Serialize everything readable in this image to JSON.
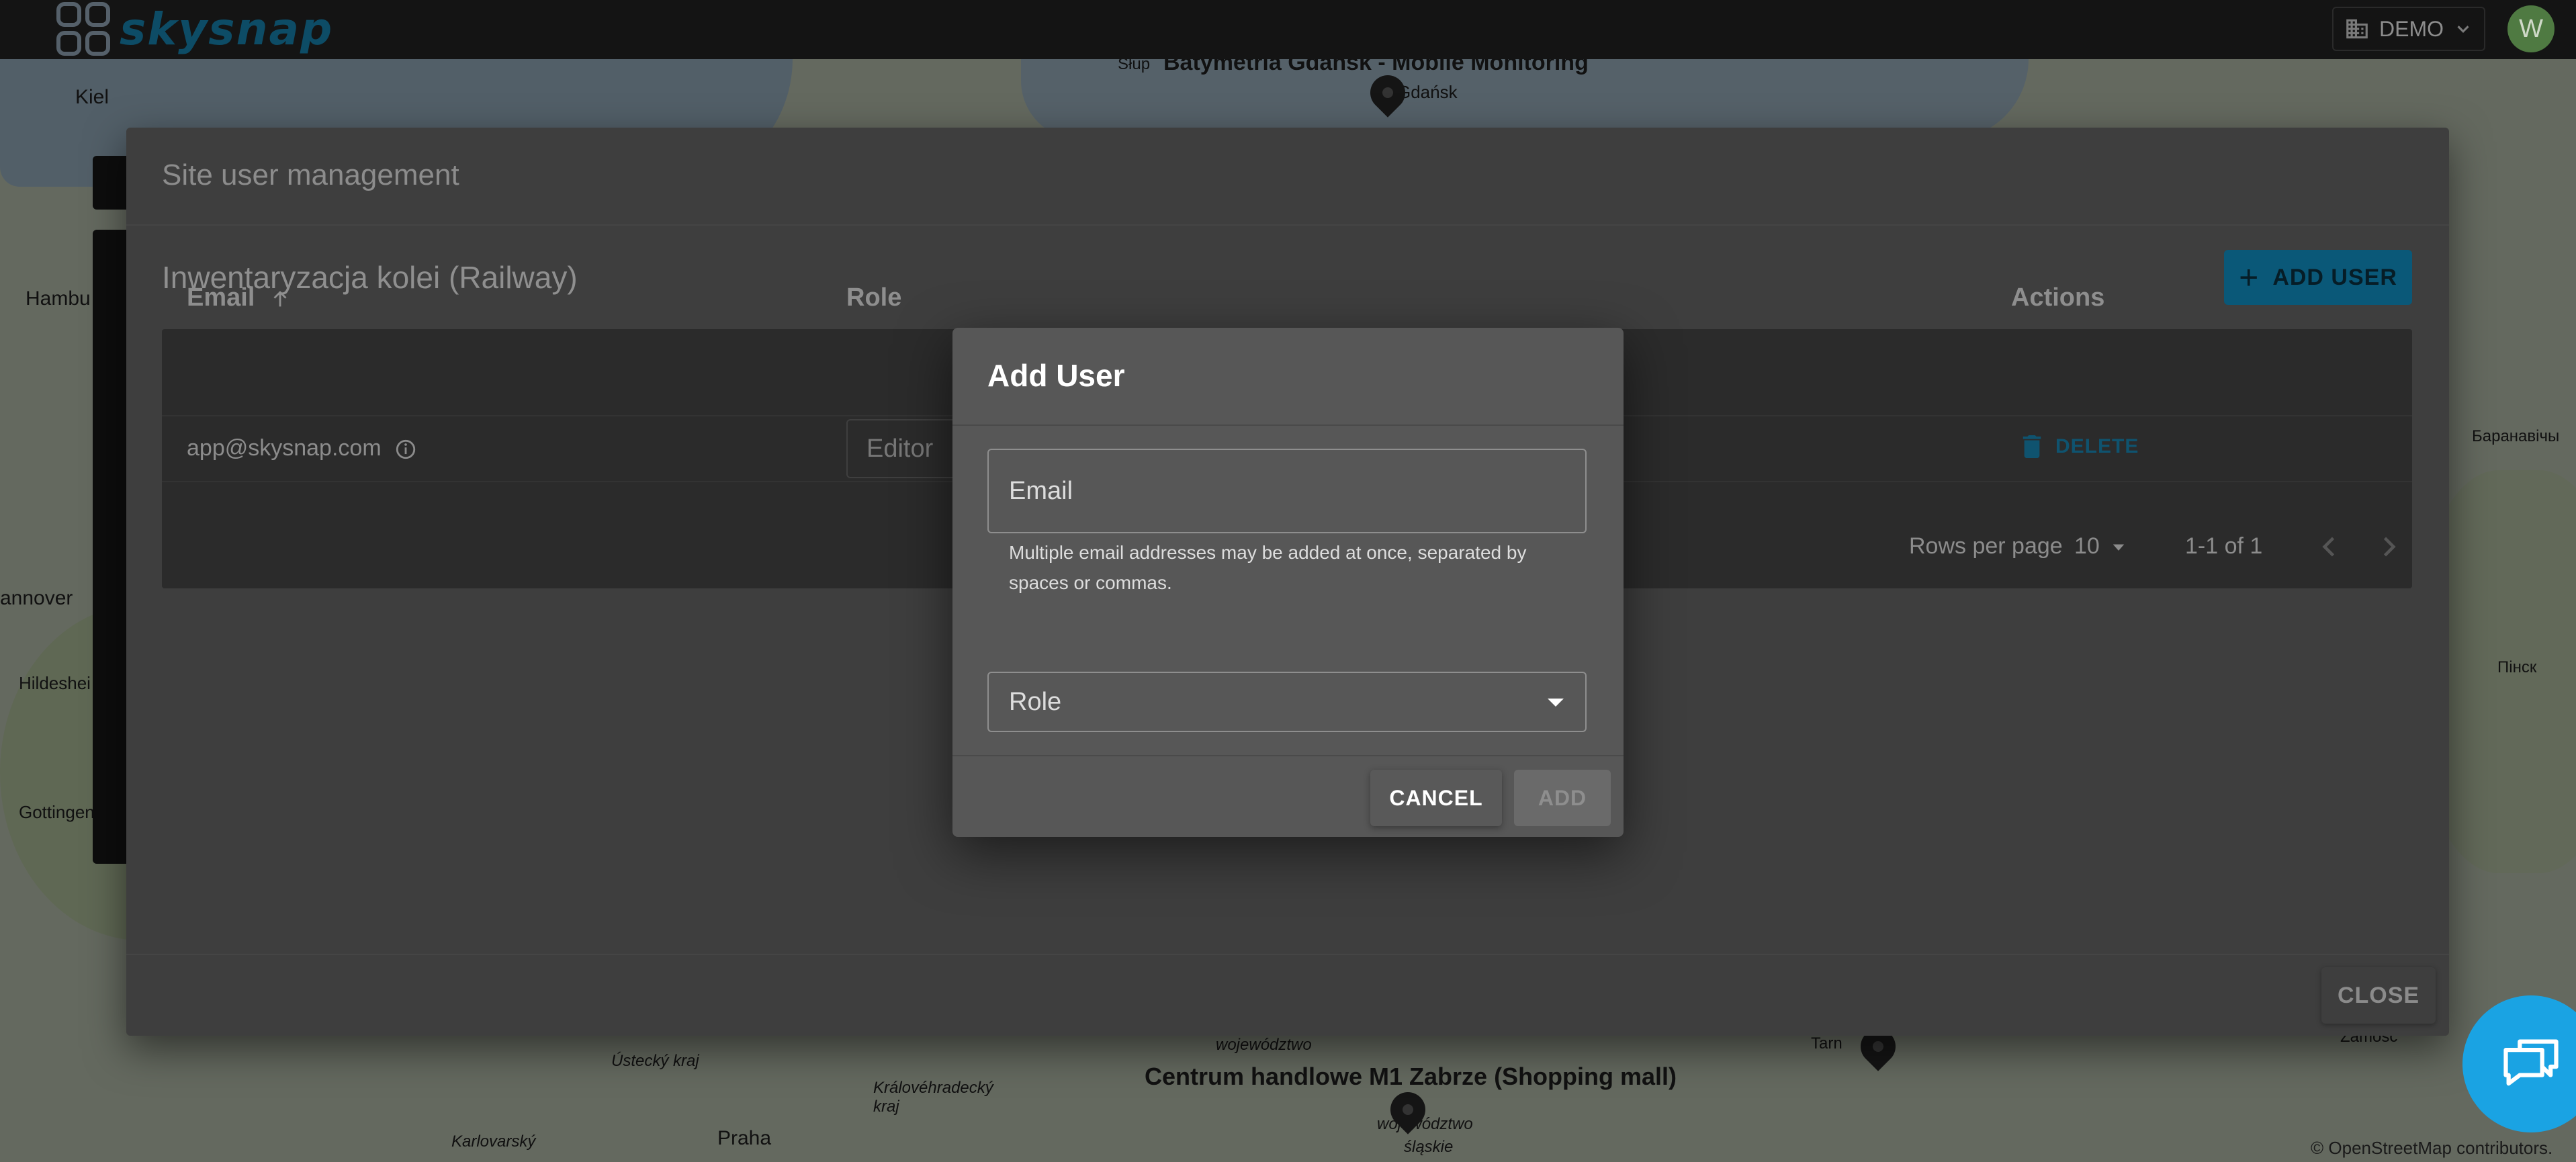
{
  "app": {
    "logo_text": "skysnap",
    "workspace": "DEMO",
    "avatar_initial": "W"
  },
  "map": {
    "labels": {
      "kiel": "Kiel",
      "hamburg": "Hambu",
      "hannover": "annover",
      "hildesheim": "Hildeshei",
      "gottingen": "Gottingen",
      "baranavichy": "Баранавічы",
      "pinsk": "Пінск",
      "site_top": "Batymetria Gdańsk - Mobile Monitoring",
      "site_top_prefix": "Słup",
      "site_top_sub": "Gdańsk",
      "site_bottom": "Centrum handlowe M1 Zabrze (Shopping mall)",
      "praha": "Praha",
      "karlovarsky": "Karlovarský",
      "ustecky": "Ústecký kraj",
      "kralovehradecky": "Královéhradecký kraj",
      "wojewodztwo_a": "województwo",
      "wojewodztwo_b": "województwo",
      "slaskie": "śląskie",
      "tarnow": "Tarn",
      "zamosc": "Zamość"
    },
    "attribution": "© OpenStreetMap contributors."
  },
  "site_user_management": {
    "title": "Site user management",
    "site_name": "Inwentaryzacja kolei (Railway)",
    "add_user_label": "ADD USER",
    "columns": {
      "email": "Email",
      "role": "Role",
      "actions": "Actions"
    },
    "rows": [
      {
        "email": "app@skysnap.com",
        "role": "Editor",
        "action": "DELETE"
      }
    ],
    "pagination": {
      "rows_per_page_label": "Rows per page",
      "rows_per_page_value": "10",
      "range": "1-1 of 1"
    },
    "close_label": "CLOSE"
  },
  "add_user_modal": {
    "title": "Add User",
    "email_placeholder": "Email",
    "helper_text": "Multiple email addresses may be added at once, separated by spaces or commas.",
    "role_placeholder": "Role",
    "cancel_label": "CANCEL",
    "add_label": "ADD"
  },
  "colors": {
    "accent": "#1aa3e3",
    "delete": "#0f536f"
  }
}
